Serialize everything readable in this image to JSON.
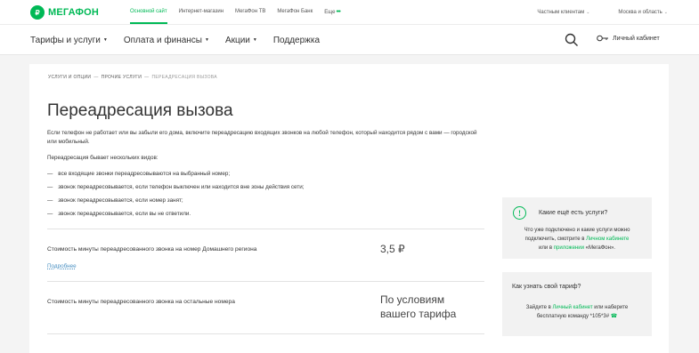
{
  "topbar": {
    "logo_mark": "₽",
    "logo_text": "МЕГАФОН",
    "links": [
      "Основной сайт",
      "Интернет-магазин",
      "МегаФон ТВ",
      "МегаФон Банк",
      "Еще"
    ],
    "more_dots": "•••",
    "right": [
      "Частным клиентам",
      "Москва и область"
    ]
  },
  "nav": {
    "items": [
      "Тарифы и услуги",
      "Оплата и финансы",
      "Акции",
      "Поддержка"
    ],
    "cabinet": "Личный кабинет"
  },
  "breadcrumb": {
    "items": [
      "УСЛУГИ И ОПЦИИ",
      "ПРОЧИЕ УСЛУГИ"
    ],
    "current": "ПЕРЕАДРЕСАЦИЯ ВЫЗОВА",
    "separator": "—"
  },
  "page": {
    "title": "Переадресация вызова",
    "intro": "Если телефон не работает или вы забыли его дома, включите переадресацию входящих звонков на любой телефон, который находится рядом с вами — городской или мобильный.",
    "types_lead": "Переадресация бывает нескольких видов:",
    "types": [
      "все входящие звонки переадресовываются на выбранный номер;",
      "звонок переадресовывается, если телефон выключен или находится вне зоны действия сети;",
      "звонок переадресовывается, если номер занят;",
      "звонок переадресовывается, если вы не ответили."
    ]
  },
  "prices": [
    {
      "label": "Стоимость минуты переадресованного звонка на номер Домашнего региона",
      "price": "3,5 ₽",
      "more": "Подробнее"
    },
    {
      "label": "Стоимость минуты переадресованного звонка на остальные номера",
      "price_line1": "По условиям",
      "price_line2": "вашего тарифа"
    }
  ],
  "side_box_1": {
    "icon": "!",
    "title": "Какие ещё есть услуги?",
    "line1": "Что уже подключено и какие услуги можно",
    "line2_pre": "подключить, смотрите в ",
    "line2_link": "Личном кабинете",
    "line3_pre": "или в ",
    "line3_link": "приложении",
    "line3_post": " «МегаФон»."
  },
  "side_box_2": {
    "title": "Как узнать свой тариф?",
    "line1_pre": "Зайдите в ",
    "line1_link": "Личный кабинет",
    "line1_post": " или наберите",
    "line2": "бесплатную команду *105*3#",
    "phone_icon": "☎"
  },
  "colors": {
    "brand": "#00b956",
    "link": "#4a90c2"
  }
}
